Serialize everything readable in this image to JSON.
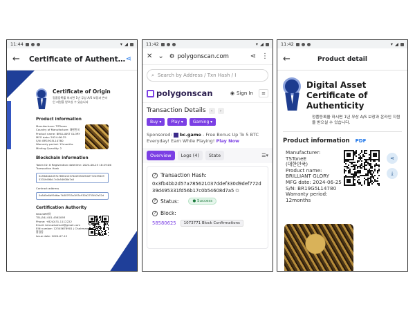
{
  "screen1": {
    "status": {
      "time": "11:44"
    },
    "appbar": {
      "title": "Certificate of Authentic···"
    },
    "cert": {
      "title": "Certificate of Origin",
      "sub": "정품등록를 하시면 1년 무상 A/S 보장과 온라인 지원을 받으실 수 있습니다",
      "product_info_title": "Product information",
      "product_info": "Manufacturer: TSTonee\nCountry of Manufacture: 대한민국\nProduct name: BRILLIANT GLORY\nMFG date: 2024-06-25\nS/N: BR19G5L14780\nWarranty period: 12months\nMinting Quantity: 2",
      "blockchain_title": "Blockchain information",
      "blockchain_info": "Token ID: 6    Registration datetime: 2024-06-25 18:29:06\nTransaction Hash",
      "hash_box": "0x3fb4bb2d57a785621037ddef330d9def772d39d495331fd56b17c0b54608d7a5",
      "contract_label": "Contract address",
      "contract_box": "0x8d5e6b95d6ac7b387f53a1f05c930b2755fd7a52d",
      "authority_title": "Certification Authority",
      "authority_info": "NGLN코리아\nTEL(54) 001-4562093\nPhone: +82(0)31-1112222\nEmail: bricswisdmail@gmail.com\nEIN number: 12345678901 | Chairman/president/CEO: 홍길동\nIssue date: 2024-07-12"
    }
  },
  "screen2": {
    "status": {
      "time": "11:42"
    },
    "browser": {
      "url": "polygonscan.com"
    },
    "search": {
      "placeholder": "Search by Address / Txn Hash / I"
    },
    "header": {
      "logo": "polygonscan",
      "signin": "Sign In"
    },
    "tx_title": "Transaction Details",
    "pills": [
      "Buy ▾",
      "Play ▾",
      "Gaming ▾"
    ],
    "sponsor": {
      "prefix": "Sponsored:",
      "brand": "bc.game",
      "text": "- Free Bonus Up To 5 BTC Everyday! Earn While Playing!",
      "cta": "Play Now"
    },
    "tabs": [
      "Overview",
      "Logs (4)",
      "State"
    ],
    "tx": {
      "hash_label": "Transaction Hash:",
      "hash": "0x3fb4bb2d57a785621037ddef330d9def772d39d495331fd56b17c0b54608d7a5",
      "status_label": "Status:",
      "status": "Success",
      "block_label": "Block:",
      "block": "58580625",
      "confirmations": "1073771 Block Confirmations"
    }
  },
  "screen3": {
    "status": {
      "time": "11:42"
    },
    "appbar": {
      "title": "Product detail"
    },
    "heading": "Digital Asset Certificate of Authenticity",
    "sub": "정품등록을 하시면 1년 무상 A/S 보장과 온라인 지원을 받으실 수 있습니다.",
    "product_info_title": "Product information",
    "pdf": "PDF",
    "info": {
      "manufacturer": "Manufacturer: TSToneE",
      "country": "(대한민국)",
      "name_label": "Product name:",
      "name": "BRILLIANT GLORY",
      "mfg": "MFG date: 2024-06-25",
      "sn": "S/N: BR19G5L14780",
      "warranty_label": "Warranty period:",
      "warranty": "12months"
    }
  },
  "colors": {
    "accent": "#7b3fe4",
    "cert_blue": "#1f3f99",
    "link": "#1a73e8"
  }
}
